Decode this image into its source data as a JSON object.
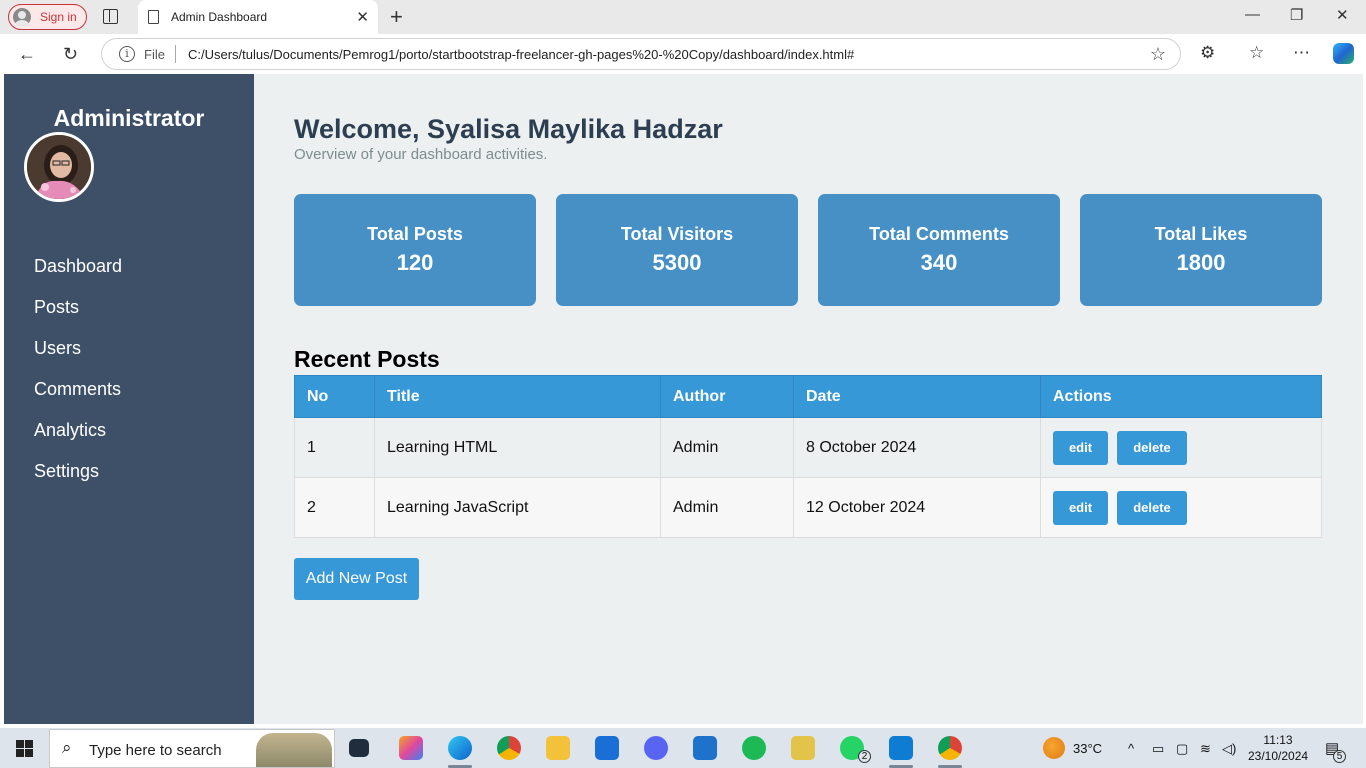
{
  "browser": {
    "signin_label": "Sign in",
    "tab_title": "Admin Dashboard",
    "file_label": "File",
    "url": "C:/Users/tulus/Documents/Pemrog1/porto/startbootstrap-freelancer-gh-pages%20-%20Copy/dashboard/index.html#"
  },
  "sidebar": {
    "title": "Administrator",
    "items": [
      {
        "label": "Dashboard"
      },
      {
        "label": "Posts"
      },
      {
        "label": "Users"
      },
      {
        "label": "Comments"
      },
      {
        "label": "Analytics"
      },
      {
        "label": "Settings"
      }
    ]
  },
  "header": {
    "welcome": "Welcome, Syalisa Maylika Hadzar",
    "subtitle": "Overview of your dashboard activities."
  },
  "stats": [
    {
      "label": "Total Posts",
      "value": "120"
    },
    {
      "label": "Total Visitors",
      "value": "5300"
    },
    {
      "label": "Total Comments",
      "value": "340"
    },
    {
      "label": "Total Likes",
      "value": "1800"
    }
  ],
  "recent_posts": {
    "title": "Recent Posts",
    "columns": [
      "No",
      "Title",
      "Author",
      "Date",
      "Actions"
    ],
    "rows": [
      {
        "no": "1",
        "title": "Learning HTML",
        "author": "Admin",
        "date": "8 October 2024"
      },
      {
        "no": "2",
        "title": "Learning JavaScript",
        "author": "Admin",
        "date": "12 October 2024"
      }
    ],
    "edit_label": "edit",
    "delete_label": "delete"
  },
  "add_post_label": "Add New Post",
  "taskbar": {
    "search_placeholder": "Type here to search",
    "weather": "33°C",
    "time": "11:13",
    "date": "23/10/2024",
    "notif_count": "5",
    "whatsapp_badge": "2"
  },
  "colors": {
    "sidebar": "#3d5068",
    "card": "#4690c6",
    "accent": "#3798d8",
    "background": "#ecf0f1"
  }
}
